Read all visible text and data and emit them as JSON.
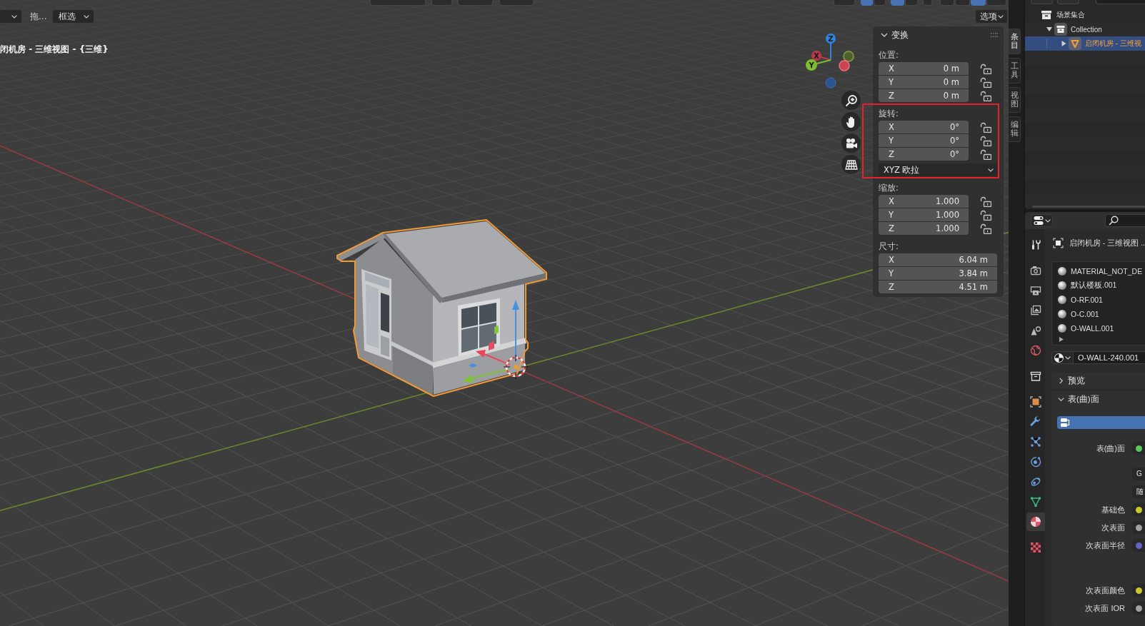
{
  "viewport": {
    "header_buttons": [
      {
        "on": false
      },
      {
        "on": false
      },
      {
        "on": false
      },
      {
        "on": false
      },
      {
        "on": false
      },
      {
        "on": true
      },
      {
        "on": false
      },
      {
        "on": true
      },
      {
        "on": false
      },
      {
        "on": false
      },
      {
        "on": false
      },
      {
        "on": false
      },
      {
        "on": true
      },
      {
        "on": false
      }
    ],
    "tool_settings": {
      "drag_label": "拖...",
      "select_mode": "框选",
      "options": "选项"
    },
    "title": "闭机房 - 三维视图 - {三维}",
    "nav_gizmo": {
      "axes": [
        {
          "label": "Z"
        },
        {
          "label": "X"
        },
        {
          "label": "Y"
        }
      ]
    },
    "nav_buttons": [
      {
        "kind": "zoom"
      },
      {
        "kind": "pan"
      },
      {
        "kind": "camera"
      },
      {
        "kind": "ortho"
      }
    ],
    "sidebar": {
      "panel": {
        "title": "变换",
        "expanded": true,
        "groups": [
          {
            "label": "位置:",
            "fields": [
              {
                "axis": "X",
                "value": "0 m",
                "locked": false
              },
              {
                "axis": "Y",
                "value": "0 m",
                "locked": false
              },
              {
                "axis": "Z",
                "value": "0 m",
                "locked": false
              }
            ]
          },
          {
            "label": "旋转:",
            "highlighted": true,
            "mode": "XYZ 欧拉",
            "fields": [
              {
                "axis": "X",
                "value": "0°",
                "locked": false
              },
              {
                "axis": "Y",
                "value": "0°",
                "locked": false
              },
              {
                "axis": "Z",
                "value": "0°",
                "locked": false
              }
            ]
          },
          {
            "label": "缩放:",
            "fields": [
              {
                "axis": "X",
                "value": "1.000",
                "locked": false
              },
              {
                "axis": "Y",
                "value": "1.000",
                "locked": false
              },
              {
                "axis": "Z",
                "value": "1.000",
                "locked": false
              }
            ]
          },
          {
            "label": "尺寸:",
            "fields": [
              {
                "axis": "X",
                "value": "6.04 m"
              },
              {
                "axis": "Y",
                "value": "3.84 m"
              },
              {
                "axis": "Z",
                "value": "4.51 m"
              }
            ]
          }
        ]
      },
      "tabs": [
        {
          "label": "条目",
          "selected": true
        },
        {
          "label": "工具",
          "selected": false
        },
        {
          "label": "视图",
          "selected": false
        },
        {
          "label": "编辑",
          "selected": false
        }
      ]
    }
  },
  "outliner": {
    "items": [
      {
        "label": "场景集合",
        "kind": "scene_collection",
        "selected": false,
        "children": [
          {
            "label": "Collection",
            "kind": "collection",
            "expanded": true,
            "selected": false,
            "children": [
              {
                "label": "启闭机房 - 三维视",
                "kind": "mesh",
                "expanded": false,
                "selected": true
              }
            ]
          }
        ]
      }
    ]
  },
  "properties": {
    "tab_groups": [
      [
        {
          "kind": "tool",
          "selected": false
        }
      ],
      [
        {
          "kind": "render",
          "selected": false
        },
        {
          "kind": "output",
          "selected": false
        },
        {
          "kind": "view_layer",
          "selected": false
        },
        {
          "kind": "scene",
          "selected": false
        },
        {
          "kind": "world",
          "selected": false
        }
      ],
      [
        {
          "kind": "collection",
          "selected": false
        }
      ],
      [
        {
          "kind": "object",
          "selected": false
        },
        {
          "kind": "modifier",
          "selected": false
        },
        {
          "kind": "particles",
          "selected": false
        },
        {
          "kind": "physics",
          "selected": false
        },
        {
          "kind": "constraints",
          "selected": false
        },
        {
          "kind": "data",
          "selected": false
        },
        {
          "kind": "material",
          "selected": true
        }
      ],
      [
        {
          "kind": "texture",
          "selected": false
        }
      ]
    ],
    "object_name": "启闭机房 - 三维视图 ..",
    "material_slots": [
      {
        "name": "MATERIAL_NOT_DE",
        "selected": false
      },
      {
        "name": "默认楼板.001",
        "selected": false
      },
      {
        "name": "O-RF.001",
        "selected": false
      },
      {
        "name": "O-C.001",
        "selected": false
      },
      {
        "name": "O-WALL.001",
        "selected": false
      }
    ],
    "material_name": "O-WALL-240.001",
    "panels": [
      {
        "title": "预览",
        "expanded": false
      },
      {
        "title": "表(曲)面",
        "expanded": true,
        "rows": [
          {
            "kind": "socket",
            "label": "表(曲)面",
            "color": "#5ac85a"
          },
          {
            "kind": "field",
            "value": "G"
          },
          {
            "kind": "field",
            "value": "随"
          },
          {
            "kind": "socket",
            "label": "基础色",
            "color": "#c8c82e"
          },
          {
            "kind": "socket",
            "label": "次表面",
            "color": "#a1a1a1"
          },
          {
            "kind": "vector",
            "label": "次表面半径",
            "color": "#6363c7"
          },
          {
            "kind": "socket",
            "label": "次表面颜色",
            "color": "#c8c82e"
          },
          {
            "kind": "socket",
            "label": "次表面 IOR",
            "color": "#a1a1a1"
          }
        ]
      }
    ]
  }
}
